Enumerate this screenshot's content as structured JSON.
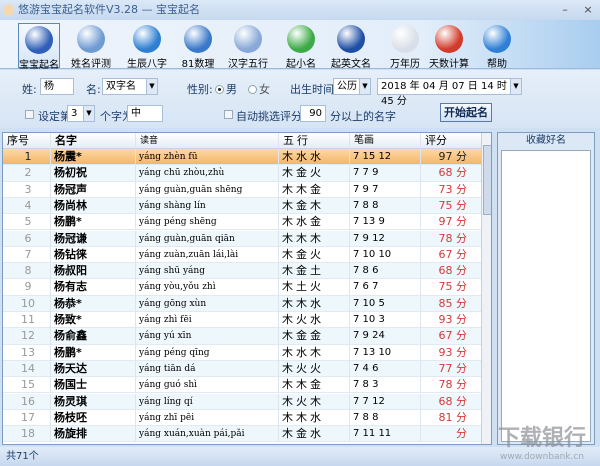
{
  "window": {
    "title": "悠游宝宝起名软件V3.28  —  宝宝起名",
    "minimize": "–",
    "close": "×"
  },
  "toolbar": [
    {
      "label": "宝宝起名",
      "icon": "accessibility-icon",
      "color": "#2f5fb8"
    },
    {
      "label": "姓名评测",
      "icon": "faces-icon",
      "color": "#6f9bd3"
    },
    {
      "label": "生辰八字",
      "icon": "user-chat-icon",
      "color": "#2e7fd1"
    },
    {
      "label": "81数理",
      "icon": "refresh-globe-icon",
      "color": "#3a79c9"
    },
    {
      "label": "汉字五行",
      "icon": "document-search-icon",
      "color": "#88a9d8"
    },
    {
      "label": "起小名",
      "icon": "cubes-icon",
      "color": "#3caa46"
    },
    {
      "label": "起英文名",
      "icon": "globe-icon",
      "color": "#1f4fa5"
    },
    {
      "label": "万年历",
      "icon": "calendar-icon",
      "color": "#d9dfe8"
    },
    {
      "label": "天数计算",
      "icon": "lifebuoy-icon",
      "color": "#d23a2a"
    },
    {
      "label": "帮助",
      "icon": "key-icon",
      "color": "#2f7fd6"
    }
  ],
  "form": {
    "surname_label": "姓:",
    "surname": "杨",
    "name_label": "名:",
    "name_type": "双字名",
    "gender_label": "性别:",
    "male": "男",
    "female": "女",
    "gender": "男",
    "birth_label": "出生时间:",
    "calendar": "公历",
    "birth": "2018 年 04 月 07 日  14 时 45 分",
    "fix_label": "设定第",
    "fix_pos": "3",
    "fix_mid": "个字为",
    "fix_char": "中",
    "auto_label": "自动挑选评分为",
    "auto_score": "90",
    "auto_suffix": "分以上的名字",
    "start": "开始起名"
  },
  "table": {
    "headers": [
      "序号",
      "名字",
      "读音",
      "五行",
      "笔画",
      "评分"
    ],
    "rows": [
      [
        "1",
        "杨震*",
        "yáng zhèn fū",
        "木水水",
        "7 15 12",
        "97 分"
      ],
      [
        "2",
        "杨初祝",
        "yáng chū zhòu,zhù",
        "木金火",
        "7 7 9",
        "68 分"
      ],
      [
        "3",
        "杨冠声",
        "yáng guàn,guān shēng",
        "木木金",
        "7 9 7",
        "73 分"
      ],
      [
        "4",
        "杨尚林",
        "yáng shàng lín",
        "木金木",
        "7 8 8",
        "75 分"
      ],
      [
        "5",
        "杨鹏*",
        "yáng péng shēng",
        "木水金",
        "7 13 9",
        "97 分"
      ],
      [
        "6",
        "杨冠谦",
        "yáng guàn,guān qiān",
        "木木木",
        "7 9 12",
        "78 分"
      ],
      [
        "7",
        "杨钻徕",
        "yáng zuàn,zuān lái,lài",
        "木金火",
        "7 10 10",
        "67 分"
      ],
      [
        "8",
        "杨叔阳",
        "yáng shū yáng",
        "木金土",
        "7 8 6",
        "68 分"
      ],
      [
        "9",
        "杨有志",
        "yáng yòu,yǒu zhì",
        "木土火",
        "7 6 7",
        "75 分"
      ],
      [
        "10",
        "杨恭*",
        "yáng gōng xùn",
        "木木水",
        "7 10 5",
        "85 分"
      ],
      [
        "11",
        "杨致*",
        "yáng zhì fēi",
        "木火水",
        "7 10 3",
        "93 分"
      ],
      [
        "12",
        "杨俞鑫",
        "yáng yú xīn",
        "木金金",
        "7 9 24",
        "67 分"
      ],
      [
        "13",
        "杨鹏*",
        "yáng péng qīng",
        "木水木",
        "7 13 10",
        "93 分"
      ],
      [
        "14",
        "杨天达",
        "yáng tiān dá",
        "木火火",
        "7 4 6",
        "77 分"
      ],
      [
        "15",
        "杨国士",
        "yáng guó shì",
        "木木金",
        "7 8 3",
        "78 分"
      ],
      [
        "16",
        "杨灵琪",
        "yáng líng qí",
        "木火木",
        "7 7 12",
        "68 分"
      ],
      [
        "17",
        "杨枝呸",
        "yáng zhī pēi",
        "木木水",
        "7 8 8",
        "81 分"
      ],
      [
        "18",
        "杨旋排",
        "yáng xuán,xuàn pái,pǎi",
        "木金水",
        "7 11 11",
        "分"
      ]
    ]
  },
  "favorites": {
    "title": "收藏好名"
  },
  "status": {
    "text": "共71个"
  },
  "watermark": {
    "text": "下载银行",
    "url": "www.downbank.cn"
  }
}
